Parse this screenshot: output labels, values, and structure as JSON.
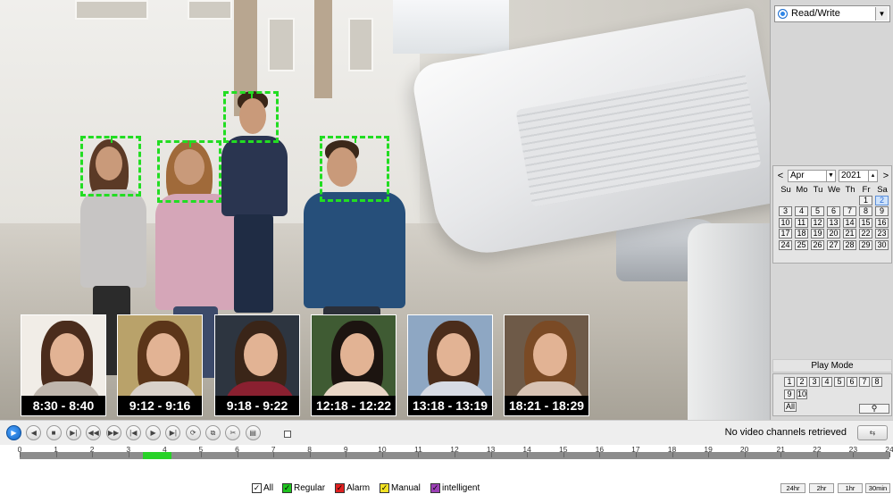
{
  "panel": {
    "mode_label": "Read/Write",
    "calendar": {
      "prev_label": "<",
      "next_label": ">",
      "month": "Apr",
      "year": "2021",
      "weekdays": [
        "Su",
        "Mo",
        "Tu",
        "We",
        "Th",
        "Fr",
        "Sa"
      ],
      "selected_day": 2,
      "days": [
        1,
        2,
        3,
        4,
        5,
        6,
        7,
        8,
        9,
        10,
        11,
        12,
        13,
        14,
        15,
        16,
        17,
        18,
        19,
        20,
        21,
        22,
        23,
        24,
        25,
        26,
        27,
        28,
        29,
        30
      ],
      "first_weekday_index": 5
    },
    "play_mode": {
      "title": "Play Mode",
      "channels": [
        "1",
        "2",
        "3",
        "4",
        "5",
        "6",
        "7",
        "8",
        "9",
        "10"
      ],
      "all_label": "All",
      "search_icon": "search-icon"
    }
  },
  "thumbnails": [
    {
      "time": "8:30 - 8:40",
      "bg": "#f1ede7",
      "hair": "#4a2c1c",
      "body": "#bfb6ad"
    },
    {
      "time": "9:12 - 9:16",
      "bg": "#b9a26a",
      "hair": "#5b3519",
      "body": "#d9d1c9"
    },
    {
      "time": "9:18 - 9:22",
      "bg": "#2d3540",
      "hair": "#3a2518",
      "body": "#8a2030"
    },
    {
      "time": "12:18 - 12:22",
      "bg": "#3f5b33",
      "hair": "#1c1410",
      "body": "#e9d6c6"
    },
    {
      "time": "13:18 - 13:19",
      "bg": "#8ea7c3",
      "hair": "#4b2d1b",
      "body": "#d7dbe4"
    },
    {
      "time": "18:21 - 18:29",
      "bg": "#6e5a48",
      "hair": "#7a4a25",
      "body": "#d8c3b4"
    }
  ],
  "toolbar": {
    "status_text": "No video channels retrieved",
    "buttons": [
      {
        "icon": "play-icon",
        "glyph": "▶"
      },
      {
        "icon": "rewind-icon",
        "glyph": "◀"
      },
      {
        "icon": "stop-icon",
        "glyph": "■"
      },
      {
        "icon": "step-forward-icon",
        "glyph": "▶|"
      },
      {
        "icon": "slow-icon",
        "glyph": "◀◀"
      },
      {
        "icon": "fast-forward-icon",
        "glyph": "▶▶"
      },
      {
        "icon": "previous-icon",
        "glyph": "|◀"
      },
      {
        "icon": "frame-icon",
        "glyph": "▶"
      },
      {
        "icon": "next-icon",
        "glyph": "▶|"
      },
      {
        "icon": "sync-icon",
        "glyph": "⟳"
      },
      {
        "icon": "clip-icon",
        "glyph": "⧉"
      },
      {
        "icon": "scissors-icon",
        "glyph": "✂"
      },
      {
        "icon": "save-icon",
        "glyph": "▤"
      }
    ],
    "refresh_glyph": "⇆"
  },
  "timeline": {
    "hours": [
      "0",
      "1",
      "2",
      "3",
      "4",
      "5",
      "6",
      "7",
      "8",
      "9",
      "10",
      "11",
      "12",
      "13",
      "14",
      "15",
      "16",
      "17",
      "18",
      "19",
      "20",
      "21",
      "22",
      "23",
      "24"
    ],
    "recordings": [
      {
        "start_hour": 3.4,
        "end_hour": 4.2
      }
    ]
  },
  "legend": {
    "items": [
      {
        "label": "All",
        "color": "#ffffff",
        "check": "✓"
      },
      {
        "label": "Regular",
        "color": "#1ec31e",
        "check": "✓"
      },
      {
        "label": "Alarm",
        "color": "#e02020",
        "check": "✓"
      },
      {
        "label": "Manual",
        "color": "#f2e224",
        "check": "✓"
      },
      {
        "label": "intelligent",
        "color": "#9b3fb5",
        "check": "✓"
      }
    ],
    "ranges": [
      "24hr",
      "2hr",
      "1hr",
      "30min"
    ]
  },
  "colors": {
    "face_box": "#22dd22",
    "accent": "#1565c0",
    "recording": "#27d227"
  }
}
